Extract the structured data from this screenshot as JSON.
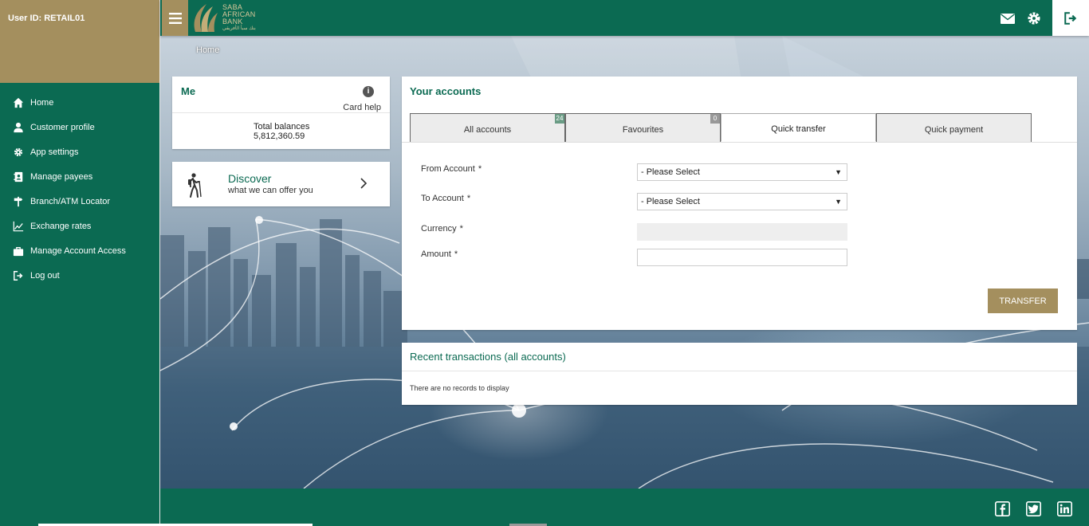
{
  "user": {
    "id_label": "User ID: RETAIL01"
  },
  "brand": {
    "name_line1": "SABA",
    "name_line2": "AFRICAN",
    "name_line3": "BANK",
    "name_arabic": "بنك سبأ الأفريقي"
  },
  "sidebar": {
    "items": [
      {
        "label": "Home",
        "icon": "home-icon"
      },
      {
        "label": "Customer profile",
        "icon": "user-icon"
      },
      {
        "label": "App settings",
        "icon": "gear-icon"
      },
      {
        "label": "Manage payees",
        "icon": "address-book-icon"
      },
      {
        "label": "Branch/ATM Locator",
        "icon": "signpost-icon"
      },
      {
        "label": "Exchange rates",
        "icon": "line-chart-icon"
      },
      {
        "label": "Manage Account Access",
        "icon": "briefcase-icon"
      },
      {
        "label": "Log out",
        "icon": "logout-icon"
      }
    ]
  },
  "breadcrumb": {
    "home": "Home"
  },
  "me_card": {
    "title": "Me",
    "info_glyph": "i",
    "card_help": "Card help",
    "total_label": "Total balances",
    "total_value": "5,812,360.59"
  },
  "discover": {
    "title": "Discover",
    "subtitle": "what we can offer you"
  },
  "accounts": {
    "title": "Your accounts",
    "tabs": [
      {
        "label": "All accounts",
        "badge": "24",
        "badge_color": "#6a9c85"
      },
      {
        "label": "Favourites",
        "badge": "0",
        "badge_color": "#999999"
      },
      {
        "label": "Quick transfer",
        "badge": ""
      },
      {
        "label": "Quick payment",
        "badge": ""
      }
    ],
    "active_tab": "Quick transfer",
    "form": {
      "from_label": "From Account",
      "to_label": "To Account",
      "currency_label": "Currency",
      "amount_label": "Amount",
      "required_mark": "*",
      "from_value": "- Please Select",
      "to_value": "- Please Select",
      "currency_value": "",
      "amount_value": "",
      "dropdown_arrow": "▼",
      "submit_label": "TRANSFER"
    }
  },
  "recent": {
    "title": "Recent transactions (all accounts)",
    "empty_text": "There are no records to display"
  },
  "colors": {
    "primary": "#0b6a52",
    "gold": "#a48f5e"
  }
}
